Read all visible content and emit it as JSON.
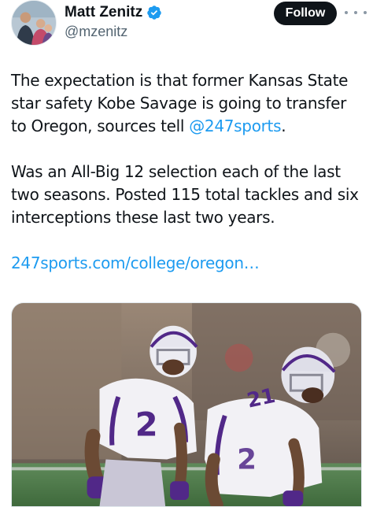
{
  "author": {
    "display_name": "Matt Zenitz",
    "handle": "@mzenitz",
    "verified_icon": "verified-badge-icon",
    "avatar_icon": "profile-avatar"
  },
  "actions": {
    "follow_label": "Follow",
    "more_icon": "more-options-icon"
  },
  "tweet": {
    "para1_text": "The expectation is that former Kansas State star safety Kobe Savage is going to transfer to Oregon, sources tell ",
    "para1_mention": "@247sports",
    "para1_end": ".",
    "para2_text": "Was an All-Big 12 selection each of the last two seasons. Posted 115 total tackles and six interceptions these last two years.",
    "link_text": "247sports.com/college/oregon…"
  },
  "media": {
    "jersey_front": "2",
    "jersey_back": "21"
  },
  "colors": {
    "link": "#1d9bf0",
    "text": "#0f1419",
    "secondary": "#536471",
    "verified": "#1d9bf0",
    "ksu_purple": "#512888"
  }
}
